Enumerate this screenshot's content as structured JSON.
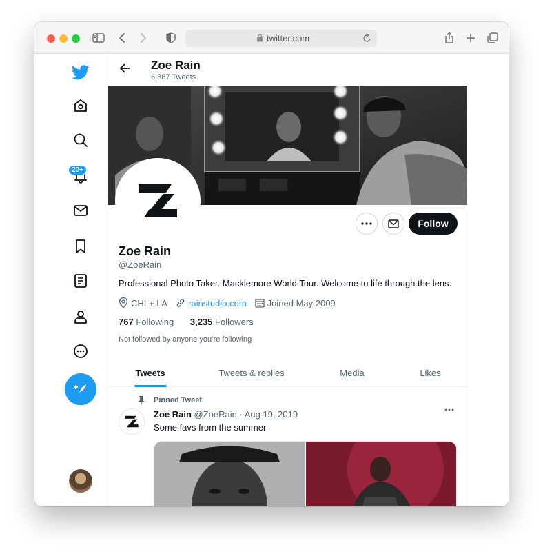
{
  "browser": {
    "url": "twitter.com",
    "traffic_colors": [
      "#ff5f57",
      "#febc2e",
      "#28c840"
    ]
  },
  "nav": {
    "badge": "20+",
    "items": [
      "twitter-logo",
      "home-icon",
      "explore-icon",
      "notifications-icon",
      "messages-icon",
      "bookmarks-icon",
      "lists-icon",
      "profile-icon",
      "more-icon"
    ],
    "accent": "#1d9bf0"
  },
  "header": {
    "name": "Zoe Rain",
    "tweet_count": "6,887 Tweets"
  },
  "profile": {
    "name": "Zoe Rain",
    "handle": "@ZoeRain",
    "bio": "Professional Photo Taker. Macklemore World Tour. Welcome to life through the lens.",
    "location": "CHI + LA",
    "website": "rainstudio.com",
    "joined": "Joined May 2009",
    "following_count": "767",
    "following_label": "Following",
    "followers_count": "3,235",
    "followers_label": "Followers",
    "followed_by": "Not followed by anyone you’re following",
    "follow_button": "Follow"
  },
  "tabs": [
    {
      "label": "Tweets",
      "active": true
    },
    {
      "label": "Tweets & replies",
      "active": false
    },
    {
      "label": "Media",
      "active": false
    },
    {
      "label": "Likes",
      "active": false
    }
  ],
  "tweet": {
    "pinned_label": "Pinned Tweet",
    "author": "Zoe Rain",
    "meta": "@ZoeRain · Aug 19, 2019",
    "text": "Some favs from the summer"
  }
}
